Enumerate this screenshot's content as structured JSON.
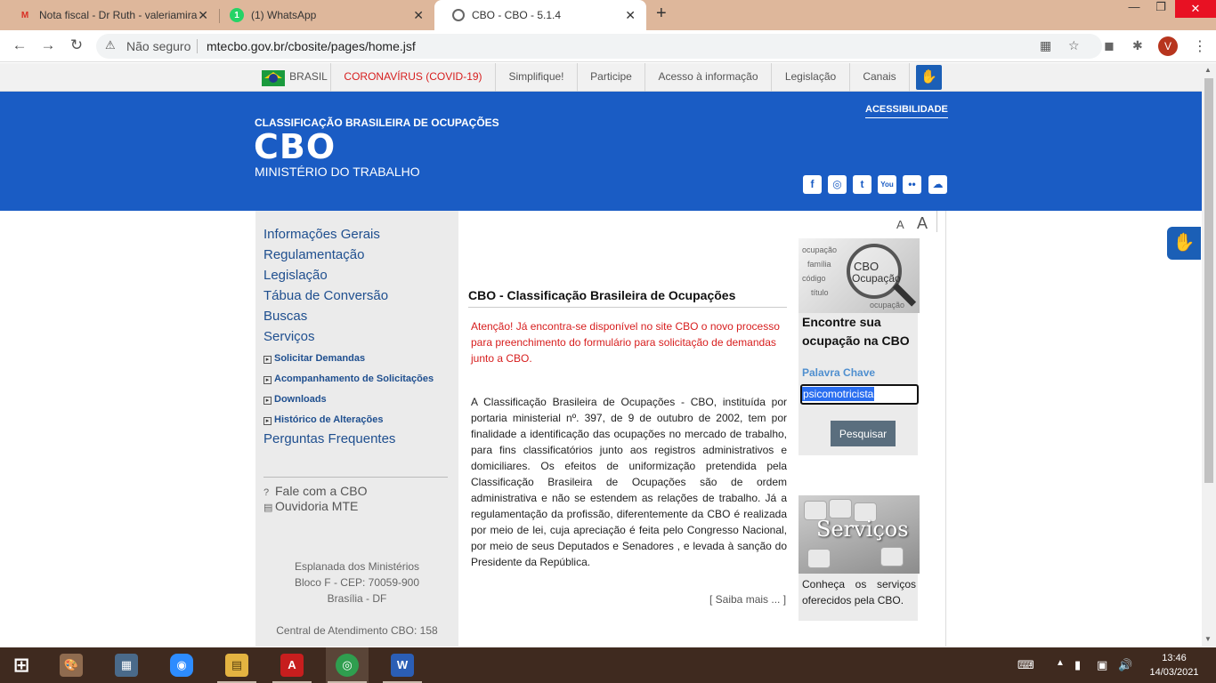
{
  "browser": {
    "tabs": [
      {
        "title": "Nota fiscal - Dr Ruth - valeriamira",
        "icon": "gmail-icon",
        "close": "✕"
      },
      {
        "title": "(1) WhatsApp",
        "icon": "whatsapp-icon",
        "badge": "1",
        "close": "✕"
      },
      {
        "title": "CBO - CBO -  5.1.4",
        "icon": "globe-icon",
        "close": "✕"
      }
    ],
    "new_tab": "+",
    "window": {
      "minimize": "—",
      "restore": "❐",
      "close": "✕"
    },
    "nav": {
      "back": "←",
      "forward": "→",
      "reload": "↻"
    },
    "security_label": "Não seguro",
    "url": "mtecbo.gov.br/cbosite/pages/home.jsf",
    "profile_initial": "V"
  },
  "gov_bar": {
    "brasil": "BRASIL",
    "links": [
      "CORONAVÍRUS (COVID-19)",
      "Simplifique!",
      "Participe",
      "Acesso à informação",
      "Legislação",
      "Canais"
    ]
  },
  "header": {
    "subtitle": "CLASSIFICAÇÃO BRASILEIRA DE OCUPAÇÕES",
    "title": "CBO",
    "ministry": "MINISTÉRIO DO TRABALHO",
    "accessibility": "ACESSIBILIDADE",
    "social": [
      "facebook-icon",
      "instagram-icon",
      "twitter-icon",
      "youtube-icon",
      "flickr-icon",
      "soundcloud-icon"
    ]
  },
  "sidebar": {
    "main_links": [
      "Informações Gerais",
      "Regulamentação",
      "Legislação",
      "Tábua de Conversão",
      "Buscas",
      "Serviços"
    ],
    "sub_links": [
      "Solicitar Demandas",
      "Acompanhamento de Solicitações",
      "Downloads",
      "Histórico de Alterações"
    ],
    "faq": "Perguntas Frequentes",
    "contact": [
      "Fale com a CBO",
      "Ouvidoria MTE"
    ],
    "address": [
      "Esplanada dos Ministérios",
      "Bloco F - CEP: 70059-900",
      "Brasília - DF"
    ],
    "phone": "Central de Atendimento CBO: 158"
  },
  "main": {
    "heading": "CBO - Classificação Brasileira de Ocupações",
    "alert": "Atenção! Já encontra-se disponível no site CBO o novo processo para preenchimento do formulário para solicitação de demandas junto a CBO.",
    "body": "A Classificação Brasileira de Ocupações - CBO, instituída por portaria ministerial nº. 397, de 9 de outubro de 2002, tem por finalidade a identificação das ocupações no mercado de trabalho, para fins classificatórios junto aos registros administrativos e domiciliares. Os efeitos de uniformização pretendida pela Classificação Brasileira de Ocupações são de ordem administrativa e não se estendem as relações de trabalho. Já a regulamentação da profissão, diferentemente da CBO é realizada por meio de lei, cuja apreciação é feita pelo Congresso Nacional, por meio de seus Deputados e Senadores , e levada à sanção do Presidente da República.",
    "read_more": "[ Saiba mais ... ]"
  },
  "right": {
    "font_small": "A",
    "font_large": "A",
    "search_image_words": [
      "CBO",
      "Ocupação"
    ],
    "search_title": "Encontre sua ocupação na CBO",
    "keyword_label": "Palavra Chave",
    "keyword_value": "psicomotricista",
    "search_button": "Pesquisar",
    "services_image_text": "Serviços",
    "services_text": "Conheça os serviços oferecidos pela CBO."
  },
  "taskbar": {
    "apps": [
      {
        "name": "start-button",
        "label": "⊞"
      },
      {
        "name": "paint-app",
        "label": "🎨"
      },
      {
        "name": "calculator-app",
        "label": "▦"
      },
      {
        "name": "zoom-app",
        "label": "◉"
      },
      {
        "name": "file-explorer-app",
        "label": "▤"
      },
      {
        "name": "acrobat-app",
        "label": "A"
      },
      {
        "name": "chrome-app",
        "label": "◎"
      },
      {
        "name": "word-app",
        "label": "W"
      }
    ],
    "time": "13:46",
    "date": "14/03/2021"
  }
}
